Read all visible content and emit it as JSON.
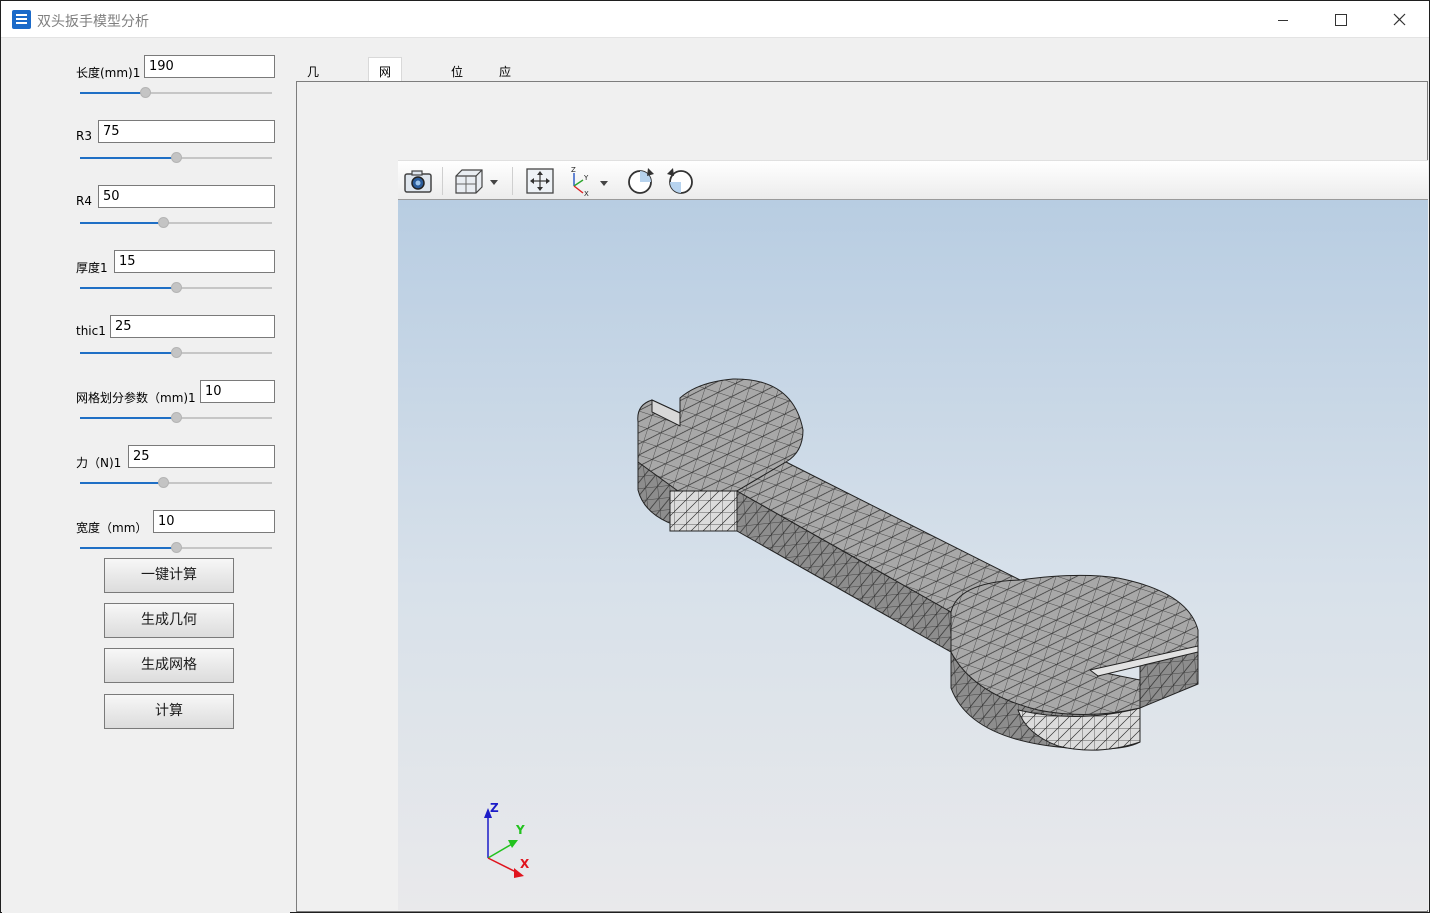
{
  "window": {
    "title": "双头扳手模型分析",
    "controls": [
      "minimize-icon",
      "maximize-icon",
      "close-icon"
    ]
  },
  "params": [
    {
      "label": "长度(mm)1",
      "value": "190",
      "slider": 0.33
    },
    {
      "label": "R3",
      "value": "75",
      "slider": 0.5
    },
    {
      "label": "R4",
      "value": "50",
      "slider": 0.43
    },
    {
      "label": "厚度1",
      "value": "15",
      "slider": 0.5
    },
    {
      "label": "thic1",
      "value": "25",
      "slider": 0.5
    },
    {
      "label": "网格划分参数（mm)1",
      "value": "10",
      "slider": 0.5
    },
    {
      "label": "力（N)1",
      "value": "25",
      "slider": 0.43
    },
    {
      "label": "宽度（mm）",
      "value": "10",
      "slider": 0.5
    }
  ],
  "buttons": {
    "compute_all": "一键计算",
    "gen_geometry": "生成几何",
    "gen_mesh": "生成网格",
    "compute": "计算"
  },
  "tabs": [
    {
      "label": "几何结构",
      "active": false
    },
    {
      "label": "网格划分",
      "active": true
    },
    {
      "label": "位移",
      "active": false
    },
    {
      "label": "应力",
      "active": false
    }
  ],
  "toolbar": {
    "icons": [
      "camera-icon",
      "cube-view-icon",
      "fit-view-icon",
      "axis-view-icon",
      "rotate-cw-icon",
      "rotate-ccw-icon"
    ]
  },
  "axes": {
    "x": "X",
    "y": "Y",
    "z": "Z"
  },
  "colors": {
    "accent": "#1f6fc5",
    "mesh_face": "#a9a9a9",
    "mesh_side_light": "#dadada",
    "axis_x": "#e0141e",
    "axis_y": "#22c21e",
    "axis_z": "#1c1cc8"
  }
}
